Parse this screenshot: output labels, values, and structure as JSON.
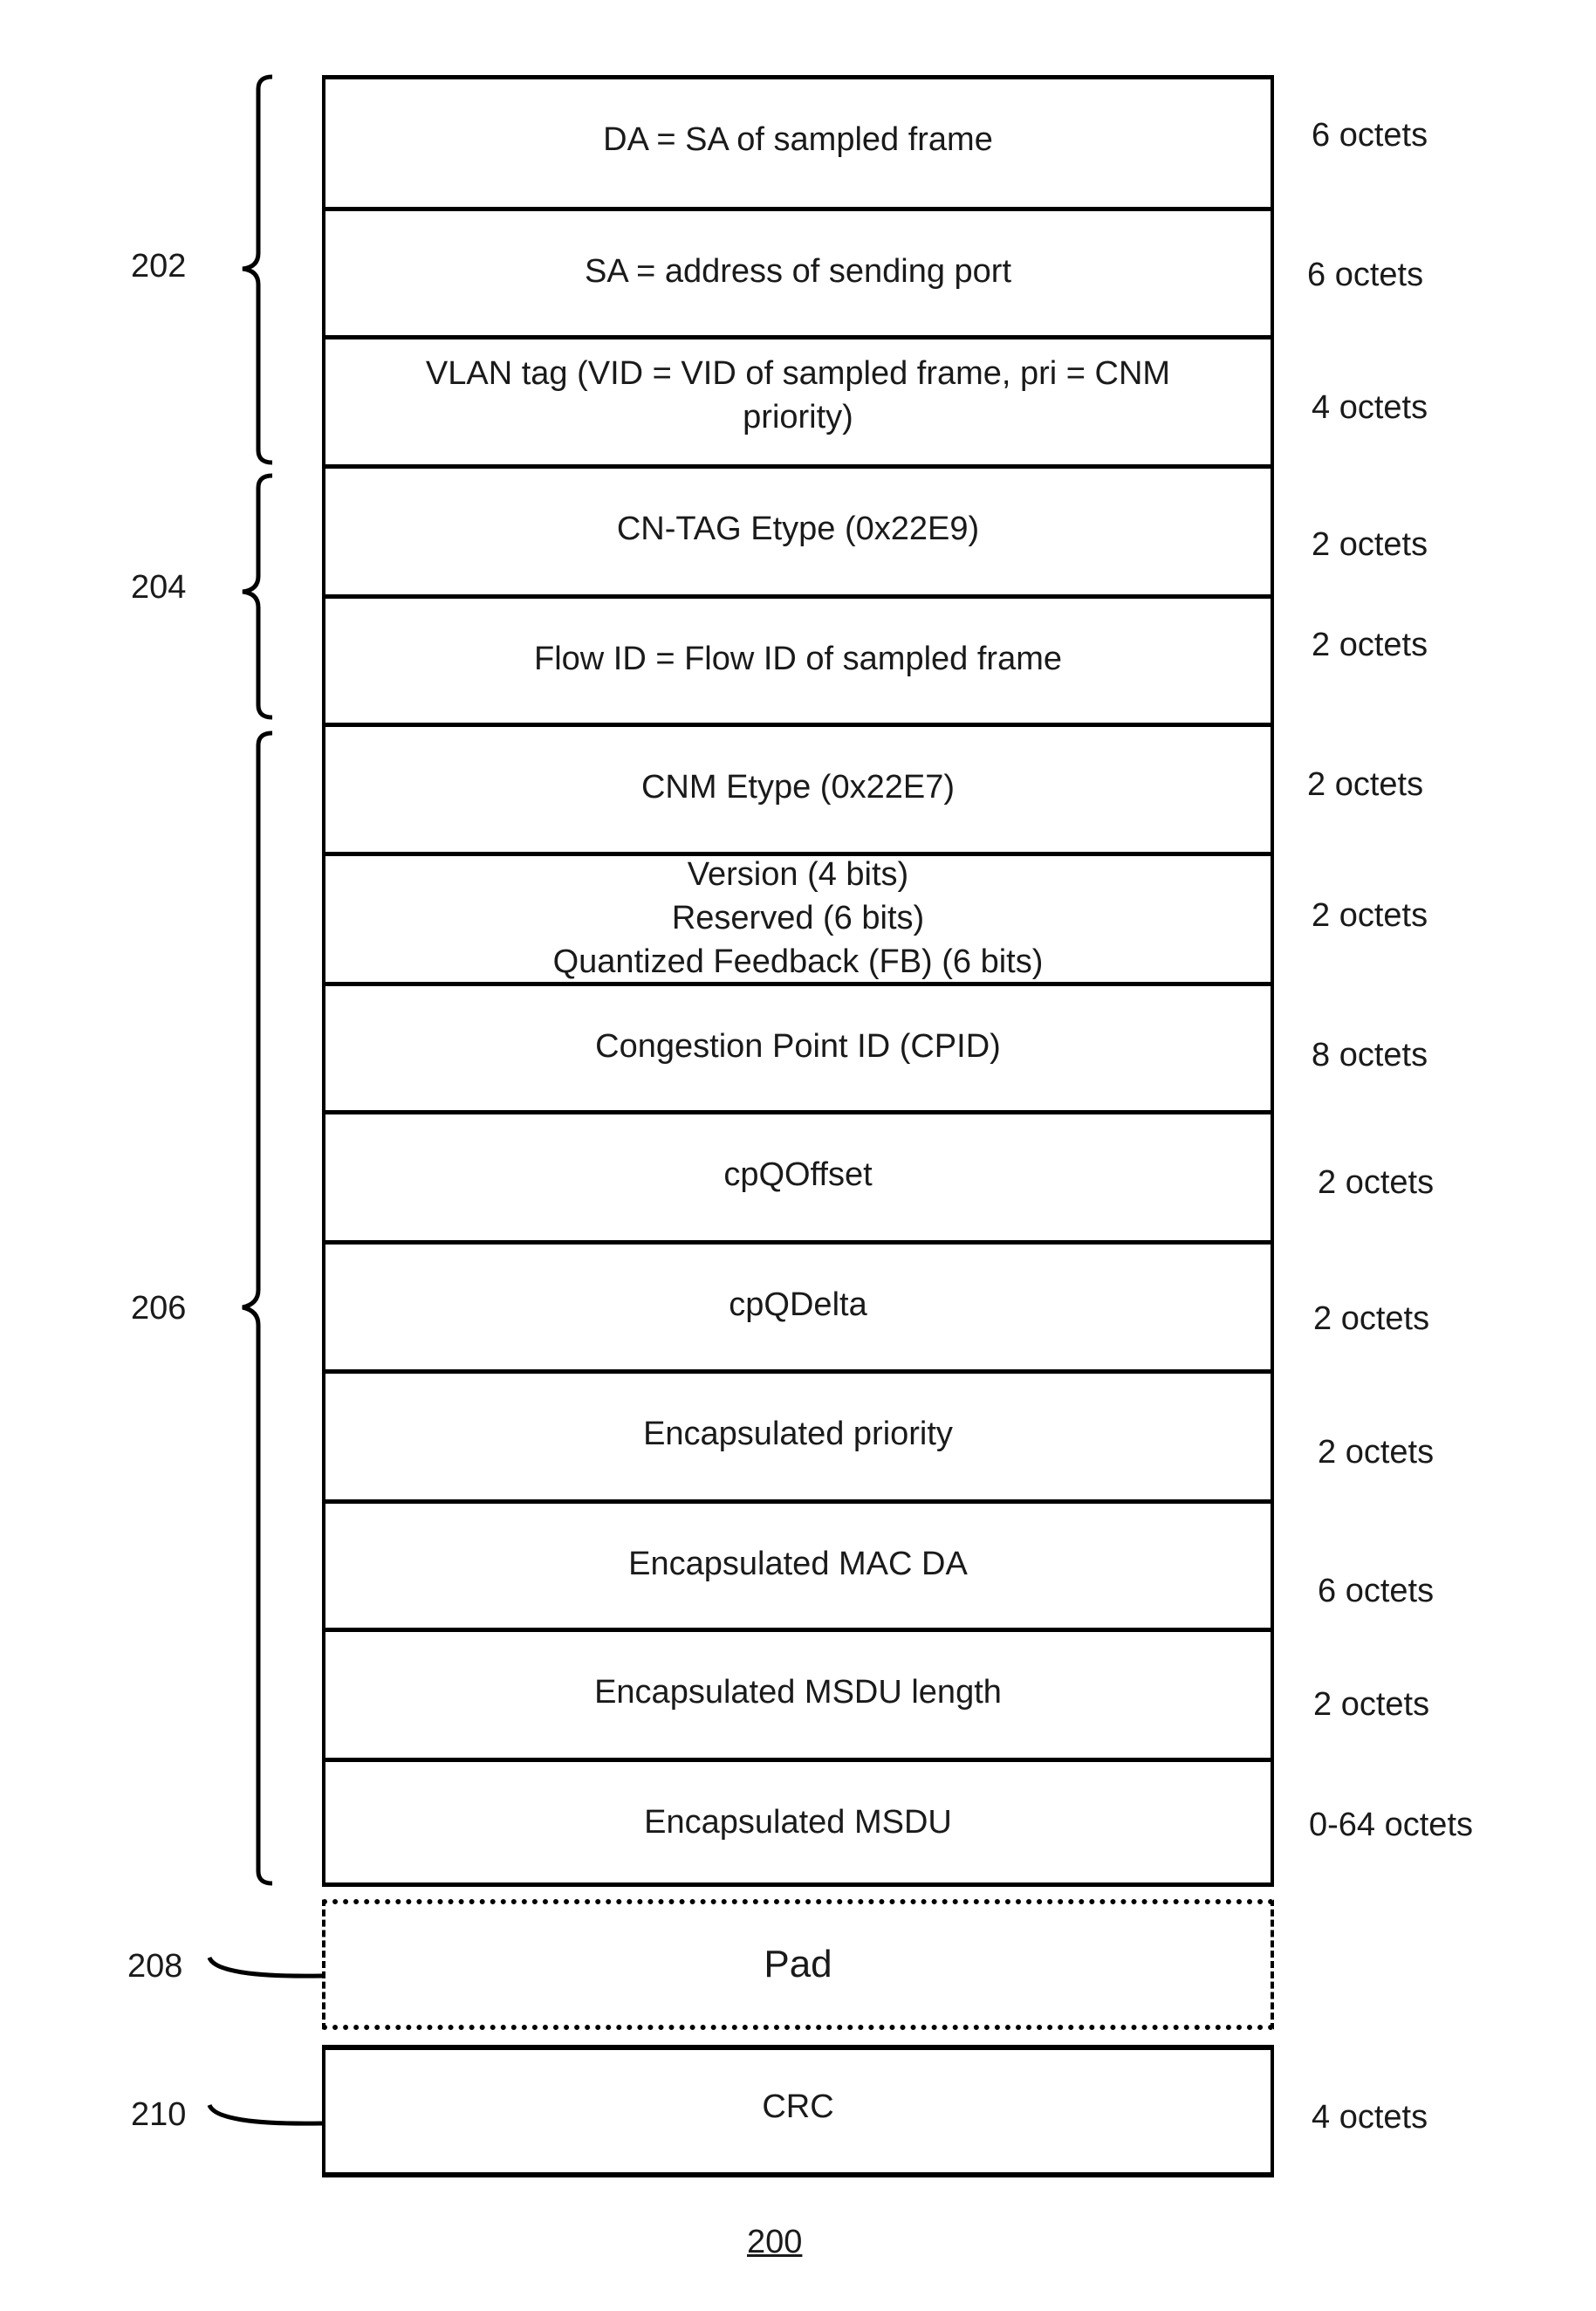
{
  "figure_number": "200",
  "fields": [
    {
      "label": "DA = SA of sampled frame",
      "size": "6 octets"
    },
    {
      "label": "SA = address of sending port",
      "size": "6 octets"
    },
    {
      "label": "VLAN tag (VID = VID of sampled frame, pri = CNM priority)",
      "size": "4 octets"
    },
    {
      "label": "CN-TAG Etype (0x22E9)",
      "size": "2 octets"
    },
    {
      "label": "Flow ID = Flow ID of sampled frame",
      "size": "2 octets"
    },
    {
      "label": "CNM Etype (0x22E7)",
      "size": "2 octets"
    },
    {
      "label_lines": [
        "Version (4 bits)",
        "Reserved (6 bits)",
        "Quantized Feedback (FB) (6 bits)"
      ],
      "size": "2 octets"
    },
    {
      "label": "Congestion Point ID (CPID)",
      "size": "8 octets"
    },
    {
      "label": "cpQOffset",
      "size": "2 octets"
    },
    {
      "label": "cpQDelta",
      "size": "2 octets"
    },
    {
      "label": "Encapsulated priority",
      "size": "2 octets"
    },
    {
      "label": "Encapsulated MAC DA",
      "size": "6 octets"
    },
    {
      "label": "Encapsulated MSDU length",
      "size": "2 octets"
    },
    {
      "label": "Encapsulated MSDU",
      "size": "0-64 octets"
    }
  ],
  "pad": {
    "label": "Pad"
  },
  "crc": {
    "label": "CRC",
    "size": "4 octets"
  },
  "groups": [
    {
      "ref": "202",
      "covers": "DA, SA, VLAN tag"
    },
    {
      "ref": "204",
      "covers": "CN-TAG Etype, Flow ID"
    },
    {
      "ref": "206",
      "covers": "CNM Etype through Encapsulated MSDU"
    },
    {
      "ref": "208",
      "covers": "Pad"
    },
    {
      "ref": "210",
      "covers": "CRC"
    }
  ]
}
